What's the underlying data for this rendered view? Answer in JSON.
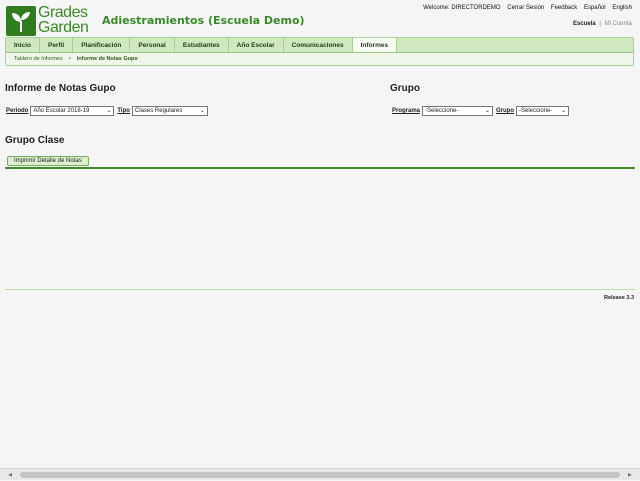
{
  "logo": {
    "line1": "Grades",
    "line2": "Garden"
  },
  "app_title": "Adiestramientos (Escuela Demo)",
  "top_links": [
    "Welcome: DIRECTORDEMO",
    "Cerrar Sesión",
    "Feedback",
    "Español",
    "English"
  ],
  "school_links": {
    "school": "Escuela",
    "sep": "|",
    "mine": "Mi Cuenta"
  },
  "nav": {
    "tabs": [
      "Inicio",
      "Perfil",
      "Planificación",
      "Personal",
      "Estudiantes",
      "Año Escolar",
      "Comunicaciones",
      "Informes"
    ],
    "active": "Informes"
  },
  "breadcrumb": {
    "parent": "Tablero de Informes",
    "sep": ">",
    "current": "Informe de Notas Gupo"
  },
  "left_section": {
    "title": "Informe de Notas Gupo",
    "periodo_label": "Periodo",
    "periodo_value": "Año Escolar 2018-19",
    "tipo_label": "Tipo",
    "tipo_value": "Clases Regulares"
  },
  "right_section": {
    "title": "Grupo",
    "programa_label": "Programa",
    "programa_value": "-Seleccione-",
    "grupo_label": "Grupo",
    "grupo_value": "-Seleccione-"
  },
  "grupo_clase": {
    "title": "Grupo Clase",
    "print_button": "Imprimir Detalle de Notas"
  },
  "release": "Release 3.3",
  "scroll": {
    "left_arrow": "◂",
    "right_arrow": "▸"
  },
  "colors": {
    "brand_green": "#3d8a2b",
    "nav_bg": "#cfe8bf"
  }
}
